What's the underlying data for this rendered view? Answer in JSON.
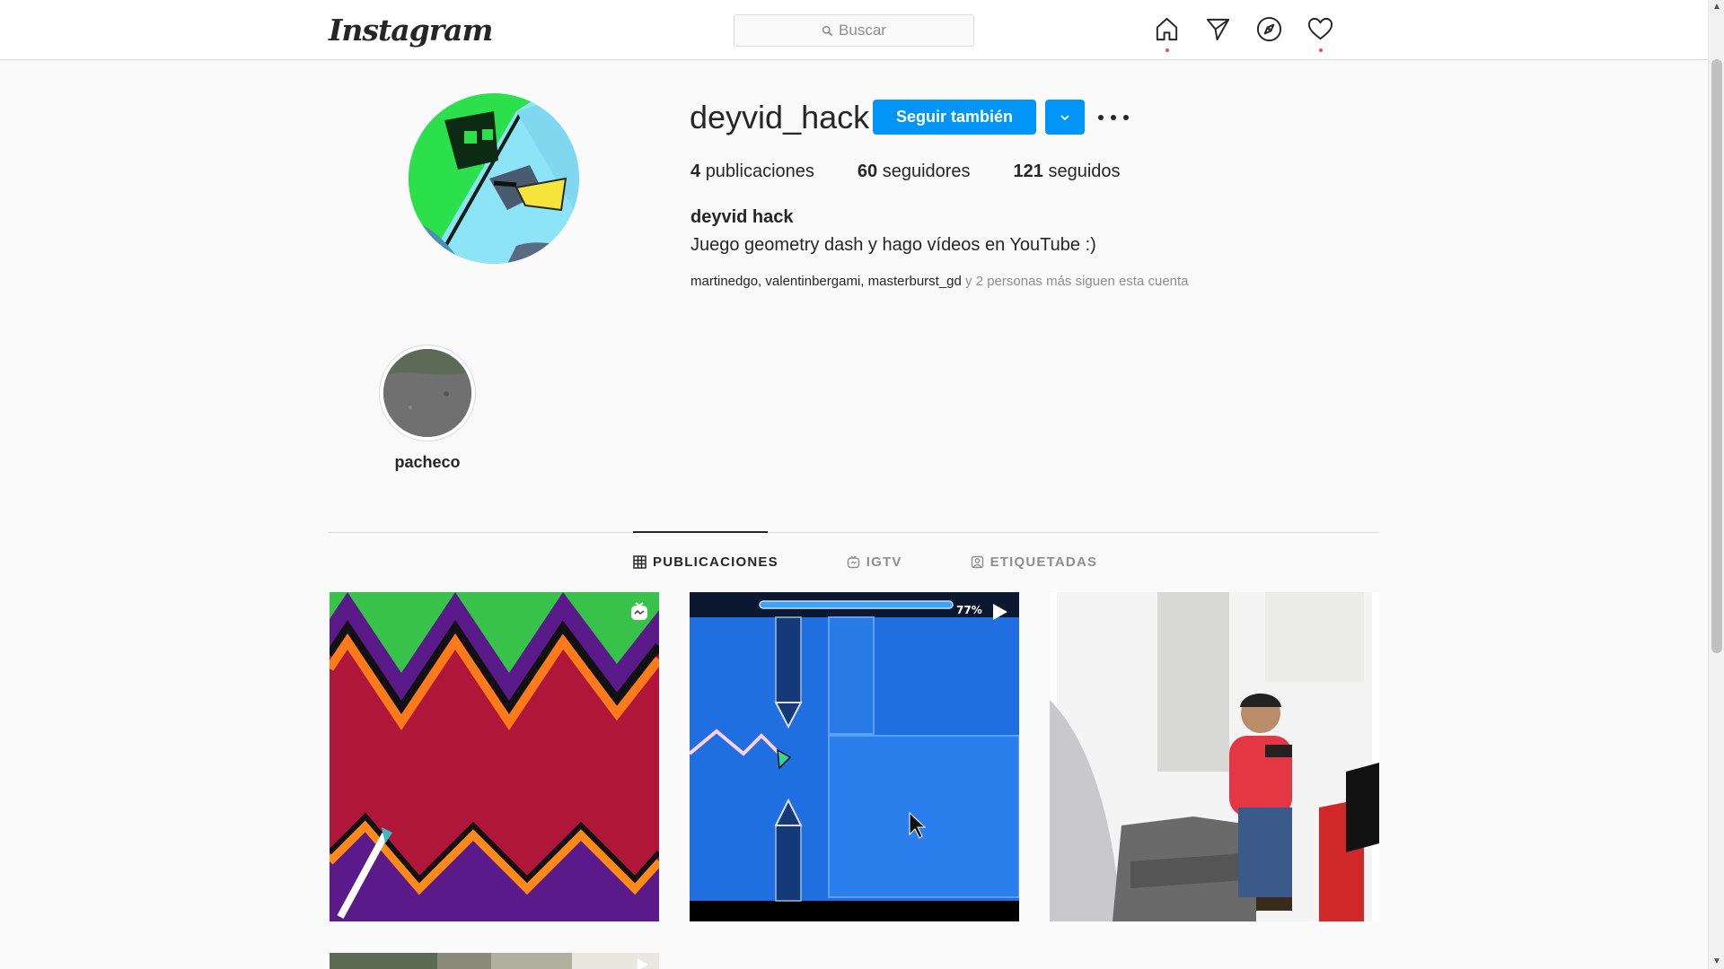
{
  "nav": {
    "logo": "Instagram",
    "search_placeholder": "Buscar",
    "icons": [
      "home-icon",
      "direct-icon",
      "explore-icon",
      "activity-heart-icon"
    ]
  },
  "profile": {
    "username": "deyvid_hack",
    "follow_button": "Seguir también",
    "stats": {
      "posts_count": "4",
      "posts_label": "publicaciones",
      "followers_count": "60",
      "followers_label": "seguidores",
      "following_count": "121",
      "following_label": "seguidos"
    },
    "full_name": "deyvid hack",
    "bio": "Juego geometry dash y hago vídeos en YouTube :)",
    "followed_by": {
      "users": [
        "martinedgo",
        "valentinbergami",
        "masterburst_gd"
      ],
      "sep1": ", ",
      "sep2": ", ",
      "suffix": " y 2 personas más siguen esta cuenta"
    }
  },
  "highlights": [
    {
      "label": "pacheco"
    }
  ],
  "tabs": [
    {
      "label": "PUBLICACIONES",
      "icon": "grid-icon",
      "active": true
    },
    {
      "label": "IGTV",
      "icon": "igtv-icon",
      "active": false
    },
    {
      "label": "ETIQUETADAS",
      "icon": "tagged-icon",
      "active": false
    }
  ],
  "posts": [
    {
      "type": "igtv",
      "badge_icon": "igtv-badge-icon"
    },
    {
      "type": "video",
      "badge_icon": "play-icon",
      "overlay_text": "77%"
    },
    {
      "type": "photo"
    },
    {
      "type": "video",
      "badge_icon": "play-icon"
    }
  ],
  "colors": {
    "primary_button": "#0095f6",
    "notification_dot": "#ed4956",
    "text": "#262626",
    "muted": "#8e8e8e"
  }
}
